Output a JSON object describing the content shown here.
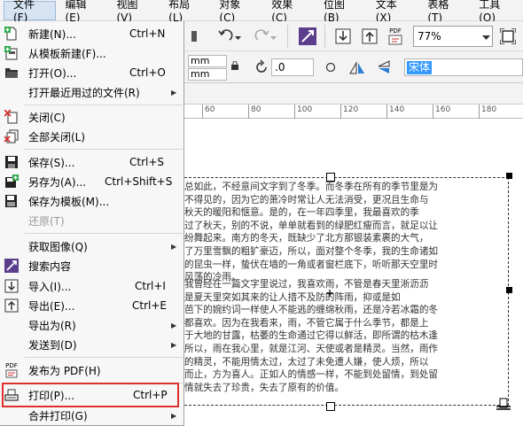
{
  "menubar": [
    {
      "label": "文件(F)",
      "active": true
    },
    {
      "label": "编辑(E)"
    },
    {
      "label": "视图(V)"
    },
    {
      "label": "布局(L)"
    },
    {
      "label": "对象(C)"
    },
    {
      "label": "效果(C)"
    },
    {
      "label": "位图(B)"
    },
    {
      "label": "文本(X)"
    },
    {
      "label": "表格(T)"
    },
    {
      "label": "工具(O)"
    }
  ],
  "toolbar": {
    "zoom_value": "77%",
    "pdf_label": "PDF",
    "unit_a": "mm",
    "unit_b": "mm",
    "angle_value": ".0",
    "font_value": "宋体"
  },
  "ruler_labels": [
    "60",
    "80",
    "100",
    "120",
    "140",
    "160",
    "180"
  ],
  "file_menu": [
    {
      "label": "新建(N)...",
      "shortcut": "Ctrl+N",
      "icon": "new-document-icon"
    },
    {
      "label": "从模板新建(F)...",
      "icon": "new-from-template-icon"
    },
    {
      "label": "打开(O)...",
      "shortcut": "Ctrl+O",
      "icon": "open-folder-icon"
    },
    {
      "label": "打开最近用过的文件(R)",
      "submenu": true
    },
    {
      "label": "关闭(C)",
      "icon": "close-document-icon"
    },
    {
      "label": "全部关闭(L)",
      "icon": "close-all-icon"
    },
    {
      "label": "保存(S)...",
      "shortcut": "Ctrl+S",
      "icon": "save-icon"
    },
    {
      "label": "另存为(A)...",
      "shortcut": "Ctrl+Shift+S",
      "icon": "save-as-icon"
    },
    {
      "label": "保存为模板(M)...",
      "icon": "save-template-icon"
    },
    {
      "label": "还原(T)",
      "disabled": true
    },
    {
      "label": "获取图像(Q)",
      "submenu": true
    },
    {
      "label": "搜索内容",
      "icon": "search-content-icon"
    },
    {
      "label": "导入(I)...",
      "shortcut": "Ctrl+I",
      "icon": "import-icon"
    },
    {
      "label": "导出(E)...",
      "shortcut": "Ctrl+E",
      "icon": "export-icon"
    },
    {
      "label": "导出为(R)",
      "submenu": true
    },
    {
      "label": "发送到(D)",
      "submenu": true
    },
    {
      "label": "发布为 PDF(H)",
      "icon": "pdf-icon",
      "icon_text": "PDF"
    },
    {
      "label": "打印(P)...",
      "shortcut": "Ctrl+P",
      "icon": "print-icon",
      "highlighted": true
    },
    {
      "label": "合并打印(G)",
      "submenu": true
    }
  ],
  "document_text": {
    "para1": [
      "总如此，不经意间文字到了冬季。而冬季在所有的季节里是为",
      "不得见的，因为它的萧冷时常让人无法消受，更况且生命与",
      "秋天的暖阳和惬意。是的，在一年四季里，我最喜欢的季",
      "过了秋天，别的不说，单单就看到的绿肥红瘦而言，就足以让",
      "纷舞起来。南方的冬天，既缺少了北方那银装素裹的大气，",
      "了万里雪飘的粗犷豪迈，所以，面对整个冬季，我的生命诸如",
      "的昆虫一样，蛰伏在墙的一角或者窗栏底下，听听那天空里时",
      "风荡的冷雨。"
    ],
    "para2": [
      "我曾经在一篇文字里说过，我喜欢雨，不管是春天里淅沥沥",
      "是夏天里突如其来的让人措不及防的阵雨，抑或是如",
      "芭下的婉约词一样使人不能逃的缠绵秋雨，还是冷若冰霜的冬",
      "都喜欢。因为在我看来，雨，不管它属于什么季节，都是上",
      "于大地的甘露，枯萎的生命通过它得以鲜活，即所谓的枯木逢",
      "所以，雨在我心里，就是江河、天使或者是精灵。当然，雨作",
      "的精灵，不能用情太过，太过了未免遭人嫌，使人烦，所以",
      "而止，方为喜人。正如人的情感一样，不能到处留情，到处留",
      "情就失去了珍贵，失去了原有的价值。"
    ]
  }
}
